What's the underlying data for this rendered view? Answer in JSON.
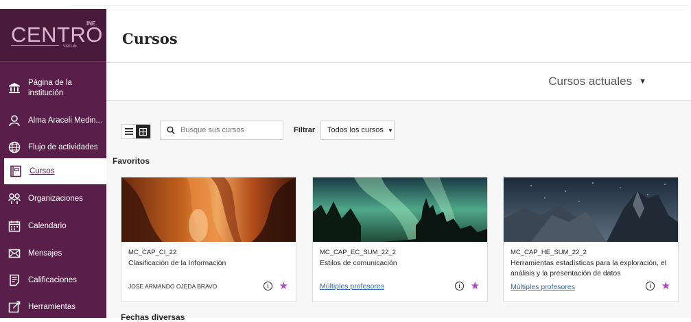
{
  "colors": {
    "sidebar": "#5a1e4a",
    "accent_star": "#b047c8",
    "link": "#2d6ca8"
  },
  "logo": {
    "text": "CENTRO",
    "superscript": "INE",
    "sub": "VIRTUAL"
  },
  "nav": [
    {
      "label": "Página de la institución",
      "icon": "institution-icon"
    },
    {
      "label": "Alma Araceli Medin...",
      "icon": "user-icon"
    },
    {
      "label": "Flujo de actividades",
      "icon": "globe-icon"
    },
    {
      "label": "Cursos",
      "icon": "courses-icon",
      "active": true
    },
    {
      "label": "Organizaciones",
      "icon": "organizations-icon"
    },
    {
      "label": "Calendario",
      "icon": "calendar-icon"
    },
    {
      "label": "Mensajes",
      "icon": "envelope-icon"
    },
    {
      "label": "Calificaciones",
      "icon": "grades-icon"
    },
    {
      "label": "Herramientas",
      "icon": "tools-icon"
    }
  ],
  "page": {
    "title": "Cursos"
  },
  "term_selector": {
    "value": "Cursos actuales"
  },
  "toolbar": {
    "search_placeholder": "Busque sus cursos",
    "filter_label": "Filtrar",
    "filter_value": "Todos los cursos"
  },
  "sections": {
    "favorites": "Favoritos",
    "dates": "Fechas diversas"
  },
  "courses": [
    {
      "code": "MC_CAP_CI_22",
      "name": "Clasificación de la Información",
      "instructor": "JOSE ARMANDO OJEDA BRAVO",
      "instructor_is_link": false,
      "favorite": true
    },
    {
      "code": "MC_CAP_EC_SUM_22_2",
      "name": "Estilos de comunicación",
      "instructor": "Múltiples profesores",
      "instructor_is_link": true,
      "favorite": true
    },
    {
      "code": "MC_CAP_HE_SUM_22_2",
      "name": "Herramientas estadísticas para la exploración, el análisis y la presentación de datos",
      "instructor": "Múltiples profesores",
      "instructor_is_link": true,
      "favorite": true
    }
  ]
}
